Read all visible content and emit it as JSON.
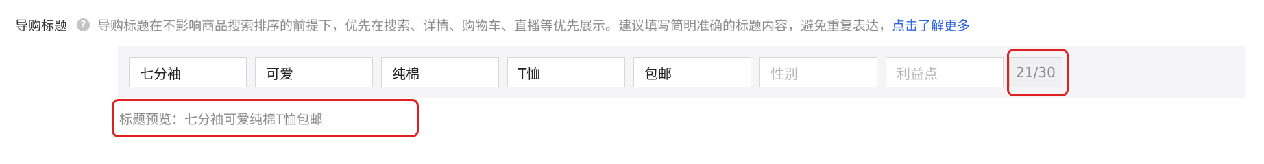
{
  "field": {
    "label": "导购标题",
    "help_icon_glyph": "?",
    "help_icon": "question-circle-icon",
    "hint": "导购标题在不影响商品搜索排序的前提下，优先在搜索、详情、购物车、直播等优先展示。建议填写简明准确的标题内容，避免重复表达，",
    "learn_more": "点击了解更多"
  },
  "tags": [
    {
      "value": "七分袖",
      "placeholder": ""
    },
    {
      "value": "可爱",
      "placeholder": ""
    },
    {
      "value": "纯棉",
      "placeholder": ""
    },
    {
      "value": "T恤",
      "placeholder": ""
    },
    {
      "value": "包邮",
      "placeholder": ""
    },
    {
      "value": "",
      "placeholder": "性别"
    },
    {
      "value": "",
      "placeholder": "利益点"
    }
  ],
  "counter": "21/30",
  "preview": {
    "label": "标题预览：",
    "text": "七分袖可爱纯棉T恤包邮"
  },
  "colors": {
    "link": "#2f67e0",
    "highlight": "#e02020",
    "panel_bg": "#f5f5f7"
  }
}
